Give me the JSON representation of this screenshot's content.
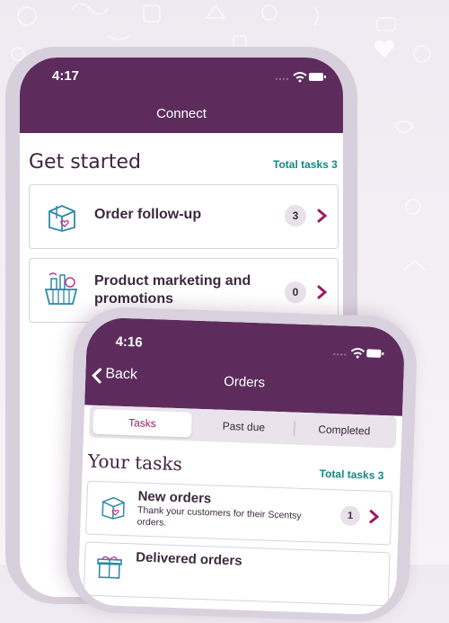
{
  "phone1": {
    "status_time": "4:17",
    "header_title": "Connect",
    "section_title": "Get started",
    "total_tasks": "Total tasks 3",
    "tasks": [
      {
        "label_line1": "Order follow-up",
        "label_line2": "",
        "count": "3",
        "icon": "gift-box-icon"
      },
      {
        "label_line1": "Product marketing and",
        "label_line2": "promotions",
        "count": "0",
        "icon": "shopping-basket-icon"
      }
    ]
  },
  "phone2": {
    "status_time": "4:16",
    "back_label": "Back",
    "header_title": "Orders",
    "segments": [
      "Tasks",
      "Past due",
      "Completed"
    ],
    "active_segment": "Tasks",
    "section_title": "Your tasks",
    "total_tasks": "Total tasks 3",
    "tasks": [
      {
        "title": "New orders",
        "subtitle_line1": "Thank your customers for their Scentsy",
        "subtitle_line2": "orders.",
        "count": "1",
        "icon": "gift-box-icon"
      },
      {
        "title": "Delivered orders",
        "subtitle_line1": "",
        "subtitle_line2": "",
        "count": "",
        "icon": "gift-icon"
      }
    ]
  },
  "colors": {
    "header_purple": "#5d2c5d",
    "accent_magenta": "#a01a63",
    "teal": "#0f8a86"
  }
}
